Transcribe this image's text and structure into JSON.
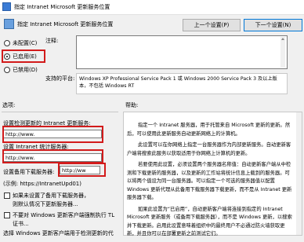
{
  "window": {
    "title": "指定 Intranet Microsoft 更新服务位置"
  },
  "header": {
    "title": "指定 Intranet Microsoft 更新服务位置"
  },
  "nav": {
    "prev_label": "上一个设置(P)",
    "next_label": "下一个设置(N)"
  },
  "state": {
    "options": [
      {
        "label": "未配置(C)",
        "checked": false
      },
      {
        "label": "已启用(E)",
        "checked": true
      },
      {
        "label": "已禁用(D)",
        "checked": false
      }
    ]
  },
  "comment": {
    "label": "注释:",
    "value": ""
  },
  "supported": {
    "label": "支持的平台:",
    "value": "Windows XP Professional Service Pack 1 或 Windows 2000 Service Pack 3 及以上版本，不包括 Windows RT"
  },
  "options_panel": {
    "title": "选项:",
    "update_service_label": "设置检测更新的 Intranet 更新服务:",
    "update_service_value": "http://www.",
    "stats_server_label": "设置 Intranet 统计服务器:",
    "stats_server_value": "http://www.",
    "alt_download_label": "设置备用下载服务器:",
    "alt_download_value": "http://ww",
    "example": "(示例:   https://IntranetUpd01)",
    "checkbox1_label": "如果未设置了备用下载服务器，",
    "checkbox1_label2": "则默认情况下更新服务器...",
    "checkbox2_label": "不要对 Windows 更新客户端强制执行 TL",
    "checkbox2_label2": "证书...",
    "footer": "选择 Windows 更新客户端用于检测更新的代"
  },
  "help_panel": {
    "title": "帮助:",
    "paragraphs": [
      "指定一个 Intranet 服务器，用于托管来自 Microsoft 更新的更新。然后，可以使用此更新服务自动更新网络上的计算机。",
      "此设置可以在你网络上指定一台服务器作为内部更新服务。自动更新客户端将搜索此服务以获取适用于你网络上计算机的更新。",
      "若要使用此设置，必须设置两个服务器名称值：自动更新客户端从中检测和下载更新的服务器，以及更新的工作站将统计信息上载到的服务器。可以将两个值设为同一台服务器。可以指定一个可选的服务器值以配置 Windows 更新代理从此备用下载服务器下载更新，而不是从 Intranet 更新服务器下载。",
      "如果此设置为“已启用”，自动更新客户端将连接到指定的 Intranet Microsoft 更新服务（或备用下载服务器），而不是 Windows 更新，以搜索并下载更新。启用此设置意味着组织中的最终用户不必通过防火墙获取更新，并且你可以在部署更新之前测试它们。"
    ]
  }
}
